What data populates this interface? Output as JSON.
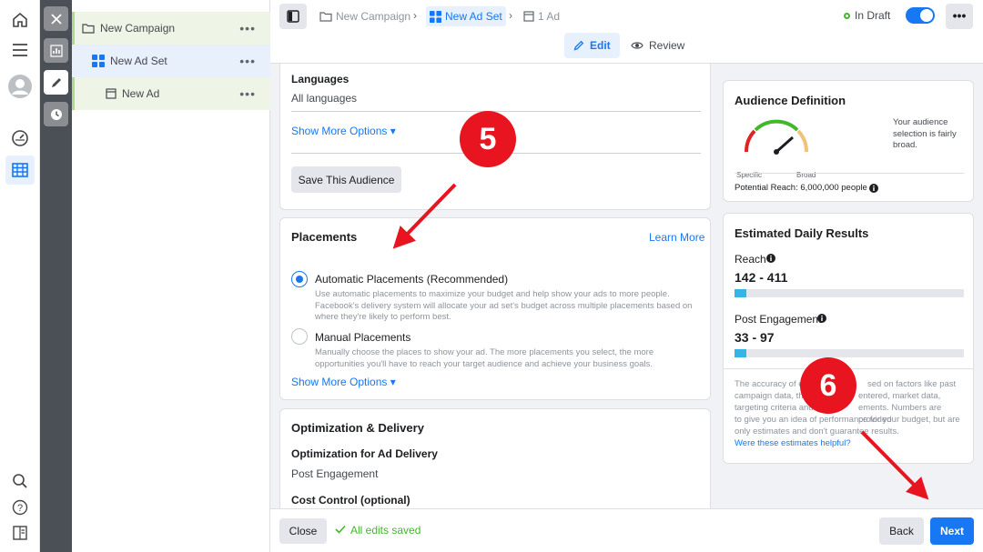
{
  "rail": {
    "icons": [
      "home-icon",
      "menu-icon",
      "avatar",
      "dashboard-icon",
      "grid-table-icon",
      "search-icon",
      "help-icon",
      "reports-icon"
    ]
  },
  "strip": {
    "icons": [
      "close-icon",
      "chart-icon",
      "pencil-icon",
      "clock-icon"
    ]
  },
  "tree": {
    "campaign": "New Campaign",
    "adset": "New Ad Set",
    "ad": "New Ad",
    "more": "•••"
  },
  "header": {
    "breadcrumb": [
      "New Campaign",
      "New Ad Set",
      "1 Ad"
    ],
    "status": "In Draft",
    "more": "•••",
    "tabs": {
      "edit": "Edit",
      "review": "Review"
    }
  },
  "audience_card": {
    "languages_label": "Languages",
    "languages_value": "All languages",
    "show_more": "Show More Options ▾",
    "save_button": "Save This Audience"
  },
  "placements_card": {
    "title": "Placements",
    "learn_more": "Learn More",
    "automatic_title": "Automatic Placements (Recommended)",
    "automatic_desc": "Use automatic placements to maximize your budget and help show your ads to more people. Facebook's delivery system will allocate your ad set's budget across multiple placements based on where they're likely to perform best.",
    "manual_title": "Manual Placements",
    "manual_desc": "Manually choose the places to show your ad. The more placements you select, the more opportunities you'll have to reach your target audience and achieve your business goals.",
    "show_more": "Show More Options ▾",
    "selected": "automatic"
  },
  "optimization_card": {
    "title": "Optimization & Delivery",
    "opt_label": "Optimization for Ad Delivery",
    "opt_value": "Post Engagement",
    "cost_label": "Cost Control (optional)"
  },
  "audience_definition": {
    "title": "Audience Definition",
    "gauge_left": "Specific",
    "gauge_right": "Broad",
    "description": "Your audience selection is fairly broad.",
    "potential_reach": "Potential Reach: 6,000,000 people"
  },
  "daily_results": {
    "title": "Estimated Daily Results",
    "reach_label": "Reach",
    "reach_value": "142 - 411",
    "reach_fill": 0.05,
    "engagement_label": "Post Engagement",
    "engagement_value": "33 - 97",
    "engagement_fill": 0.05,
    "disclaimer_l1": "The accuracy of e",
    "disclaimer_l1b": "sed on factors like past",
    "disclaimer_l2": "campaign data, th",
    "disclaimer_l2b": "entered, market data,",
    "disclaimer_l3": "targeting criteria and",
    "disclaimer_l3b": "ements. Numbers are provided",
    "disclaimer_l4": "to give you an idea of performance for your budget, but are",
    "disclaimer_l5": "only estimates and don't guarantee results.",
    "helpful_link": "Were these estimates helpful?"
  },
  "footer": {
    "close": "Close",
    "saved": "All edits saved",
    "back": "Back",
    "next": "Next"
  },
  "annotations": {
    "step5": "5",
    "step6": "6",
    "accent": "#e8141f"
  },
  "colors": {
    "brand_blue": "#1877f2",
    "saved_green": "#42b72a"
  }
}
